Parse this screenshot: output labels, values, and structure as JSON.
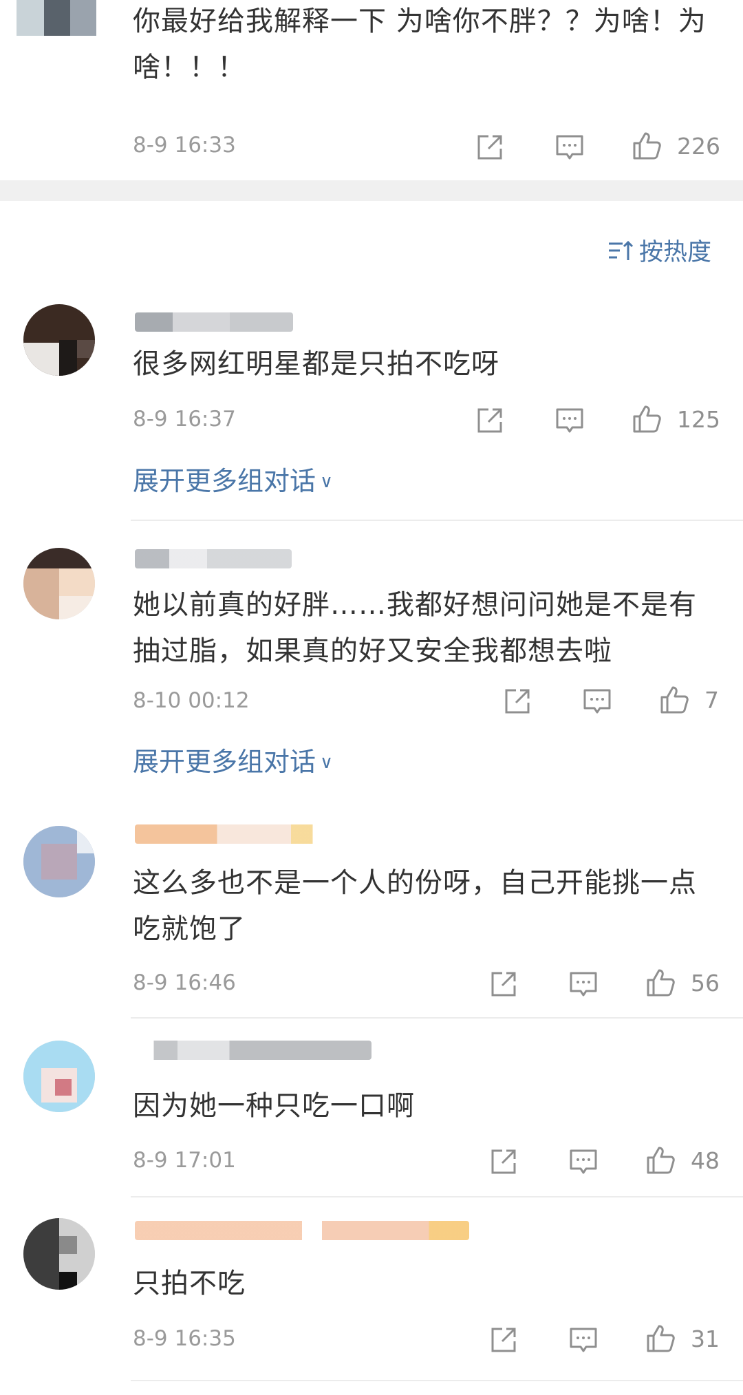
{
  "top_comment": {
    "text": "你最好给我解释一下 为啥你不胖？？为啥！为啥！！！",
    "time": "8-9 16:33",
    "likes": "226"
  },
  "sort": {
    "label": "按热度"
  },
  "comments": [
    {
      "text": "很多网红明星都是只拍不吃呀",
      "time": "8-9 16:37",
      "likes": "125",
      "expand": "展开更多组对话"
    },
    {
      "text": "她以前真的好胖……我都好想问问她是不是有抽过脂，如果真的好又安全我都想去啦",
      "time": "8-10 00:12",
      "likes": "7",
      "expand": "展开更多组对话"
    },
    {
      "text": "这么多也不是一个人的份呀，自己开能挑一点吃就饱了",
      "time": "8-9 16:46",
      "likes": "56"
    },
    {
      "text": "因为她一种只吃一口啊",
      "time": "8-9 17:01",
      "likes": "48"
    },
    {
      "text": "只拍不吃",
      "time": "8-9 16:35",
      "likes": "31"
    }
  ],
  "colors": {
    "link": "#4a76a8",
    "meta": "#9a9a9a",
    "separator": "#f0f0f0"
  },
  "icons": [
    "share-icon",
    "comment-icon",
    "like-icon",
    "chevron-down-icon",
    "sort-icon"
  ]
}
